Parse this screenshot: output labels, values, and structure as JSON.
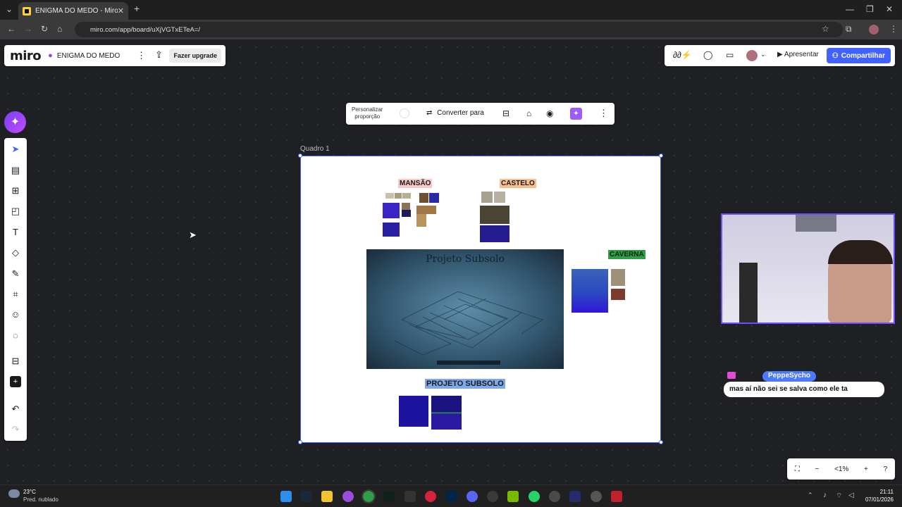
{
  "browser": {
    "tab_title": "ENIGMA DO MEDO - Miro",
    "url": "miro.com/app/board/uXjVGTxETeA=/"
  },
  "miro": {
    "logo": "miro",
    "board_name": "ENIGMA DO MEDO",
    "upgrade_label": "Fazer upgrade",
    "present_label": "Apresentar",
    "share_label": "Compartilhar",
    "context_bar": {
      "proportion_label_1": "Personalizar",
      "proportion_label_2": "proporção",
      "convert_label": "Converter para"
    },
    "frame_title": "Quadro 1",
    "sections": {
      "mansao": "MANSÃO",
      "castelo": "CASTELO",
      "caverna": "CAVERNA",
      "projeto": "PROJETO SUBSOLO"
    },
    "map_title": "Projeto Subsolo",
    "zoom_level": "<1%",
    "accent_color": "#4262ff"
  },
  "stream": {
    "chat_user": "PeppeSycho",
    "chat_message": "mas aí não sei se salva como ele ta"
  },
  "taskbar": {
    "temperature": "23°C",
    "weather": "Pred. nublado",
    "time": "21:11",
    "date": "07/01/2026"
  }
}
